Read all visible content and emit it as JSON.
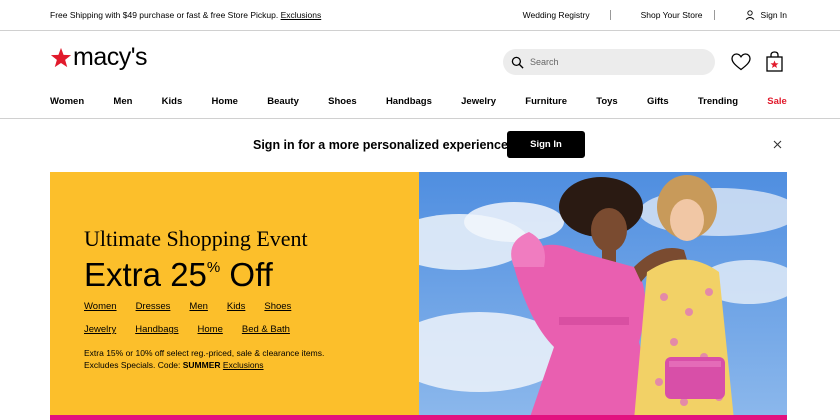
{
  "utility": {
    "promo_text": "Free Shipping with $49 purchase or fast & free Store Pickup.",
    "promo_link": "Exclusions",
    "wedding_registry": "Wedding Registry",
    "shop_your_store": "Shop Your Store",
    "sign_in": "Sign In"
  },
  "header": {
    "logo_text": "macy's",
    "search_placeholder": "Search"
  },
  "nav": {
    "items": [
      "Women",
      "Men",
      "Kids",
      "Home",
      "Beauty",
      "Shoes",
      "Handbags",
      "Jewelry",
      "Furniture",
      "Toys",
      "Gifts",
      "Trending",
      "Sale"
    ]
  },
  "signin_banner": {
    "text": "Sign in for a more personalized experience",
    "button": "Sign In"
  },
  "hero": {
    "title": "Ultimate Shopping Event",
    "offer_prefix": "Extra 25",
    "offer_percent": "%",
    "offer_suffix": " Off",
    "links_row1": [
      "Women",
      "Dresses",
      "Men",
      "Kids",
      "Shoes"
    ],
    "links_row2": [
      "Jewelry",
      "Handbags",
      "Home",
      "Bed & Bath"
    ],
    "fine_line1": "Extra 15% or 10% off select reg.-priced, sale & clearance items.",
    "fine_line2_prefix": "Excludes Specials. Code: ",
    "fine_code": "SUMMER",
    "fine_link": "Exclusions"
  },
  "colors": {
    "brand_red": "#e11a2c",
    "hero_yellow": "#fcbf2b",
    "hero_strip": "#e2127f"
  }
}
